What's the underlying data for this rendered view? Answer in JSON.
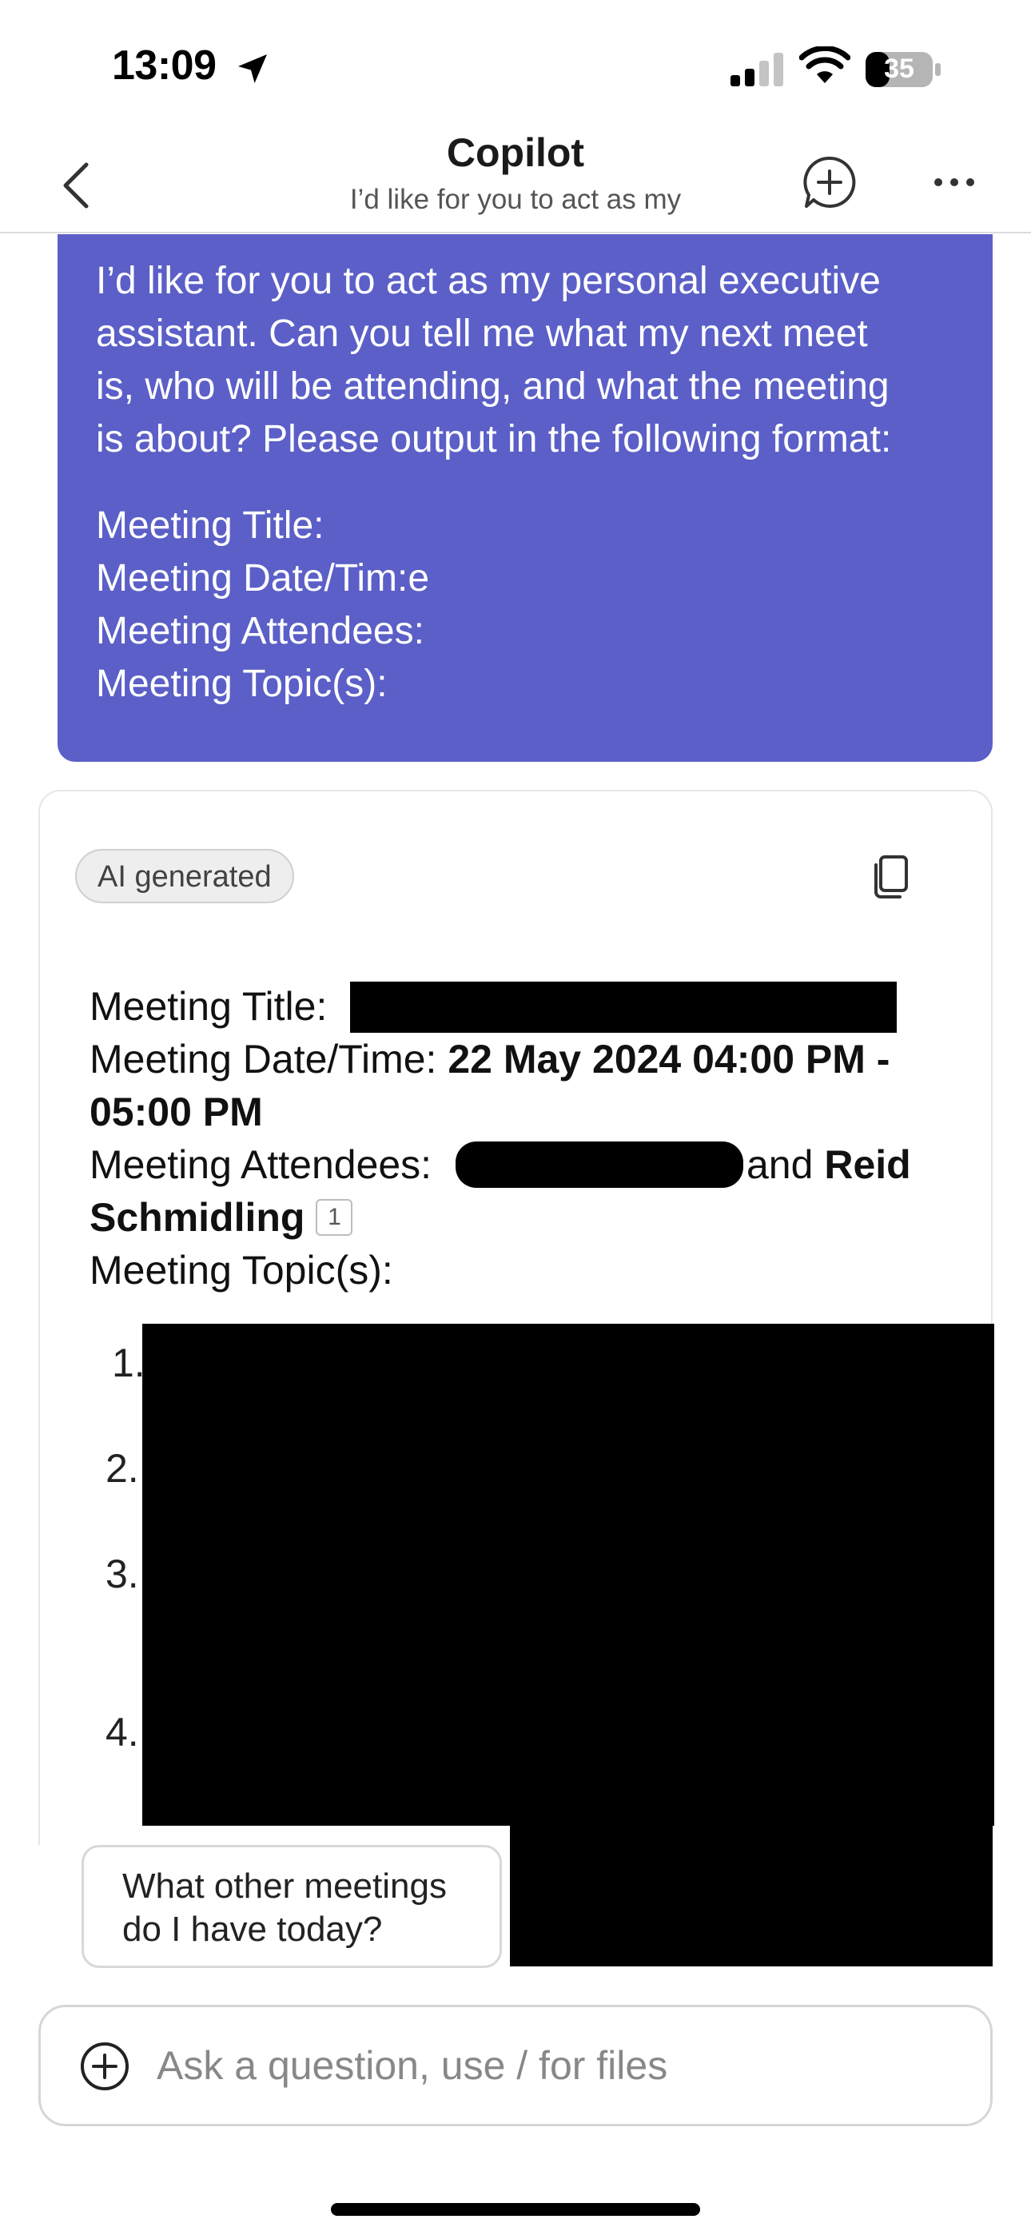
{
  "status_bar": {
    "time": "13:09",
    "battery": "35"
  },
  "header": {
    "title": "Copilot",
    "subtitle": "I’d like for you to act as my"
  },
  "user_message": {
    "lines": [
      "I’d like for you to act as my personal executive",
      "assistant. Can you tell me what my next meet",
      "is, who will be attending, and what the meeting",
      "is about? Please output in the following format:"
    ],
    "format_lines": [
      "Meeting Title:",
      "Meeting Date/Tim:e",
      "Meeting Attendees:",
      "Meeting Topic(s):"
    ]
  },
  "ai_response": {
    "badge": "AI generated",
    "title_label": "Meeting Title:",
    "datetime_label": "Meeting Date/Time:",
    "datetime_value_1": "22 May 2024 04:00 PM -",
    "datetime_value_2": "05:00 PM",
    "attendees_label": "Meeting Attendees:",
    "attendees_and": "and",
    "attendee_1": "Reid",
    "attendee_2": "Schmidling",
    "citation": "1",
    "topics_label": "Meeting Topic(s):",
    "topic_numbers": [
      "1.",
      "2.",
      "3.",
      "4."
    ]
  },
  "suggestions": [
    "What other meetings do I have today?"
  ],
  "input": {
    "placeholder": "Ask a question, use / for files"
  },
  "colors": {
    "accent": "#5b5fc7",
    "redaction": "#000000"
  }
}
